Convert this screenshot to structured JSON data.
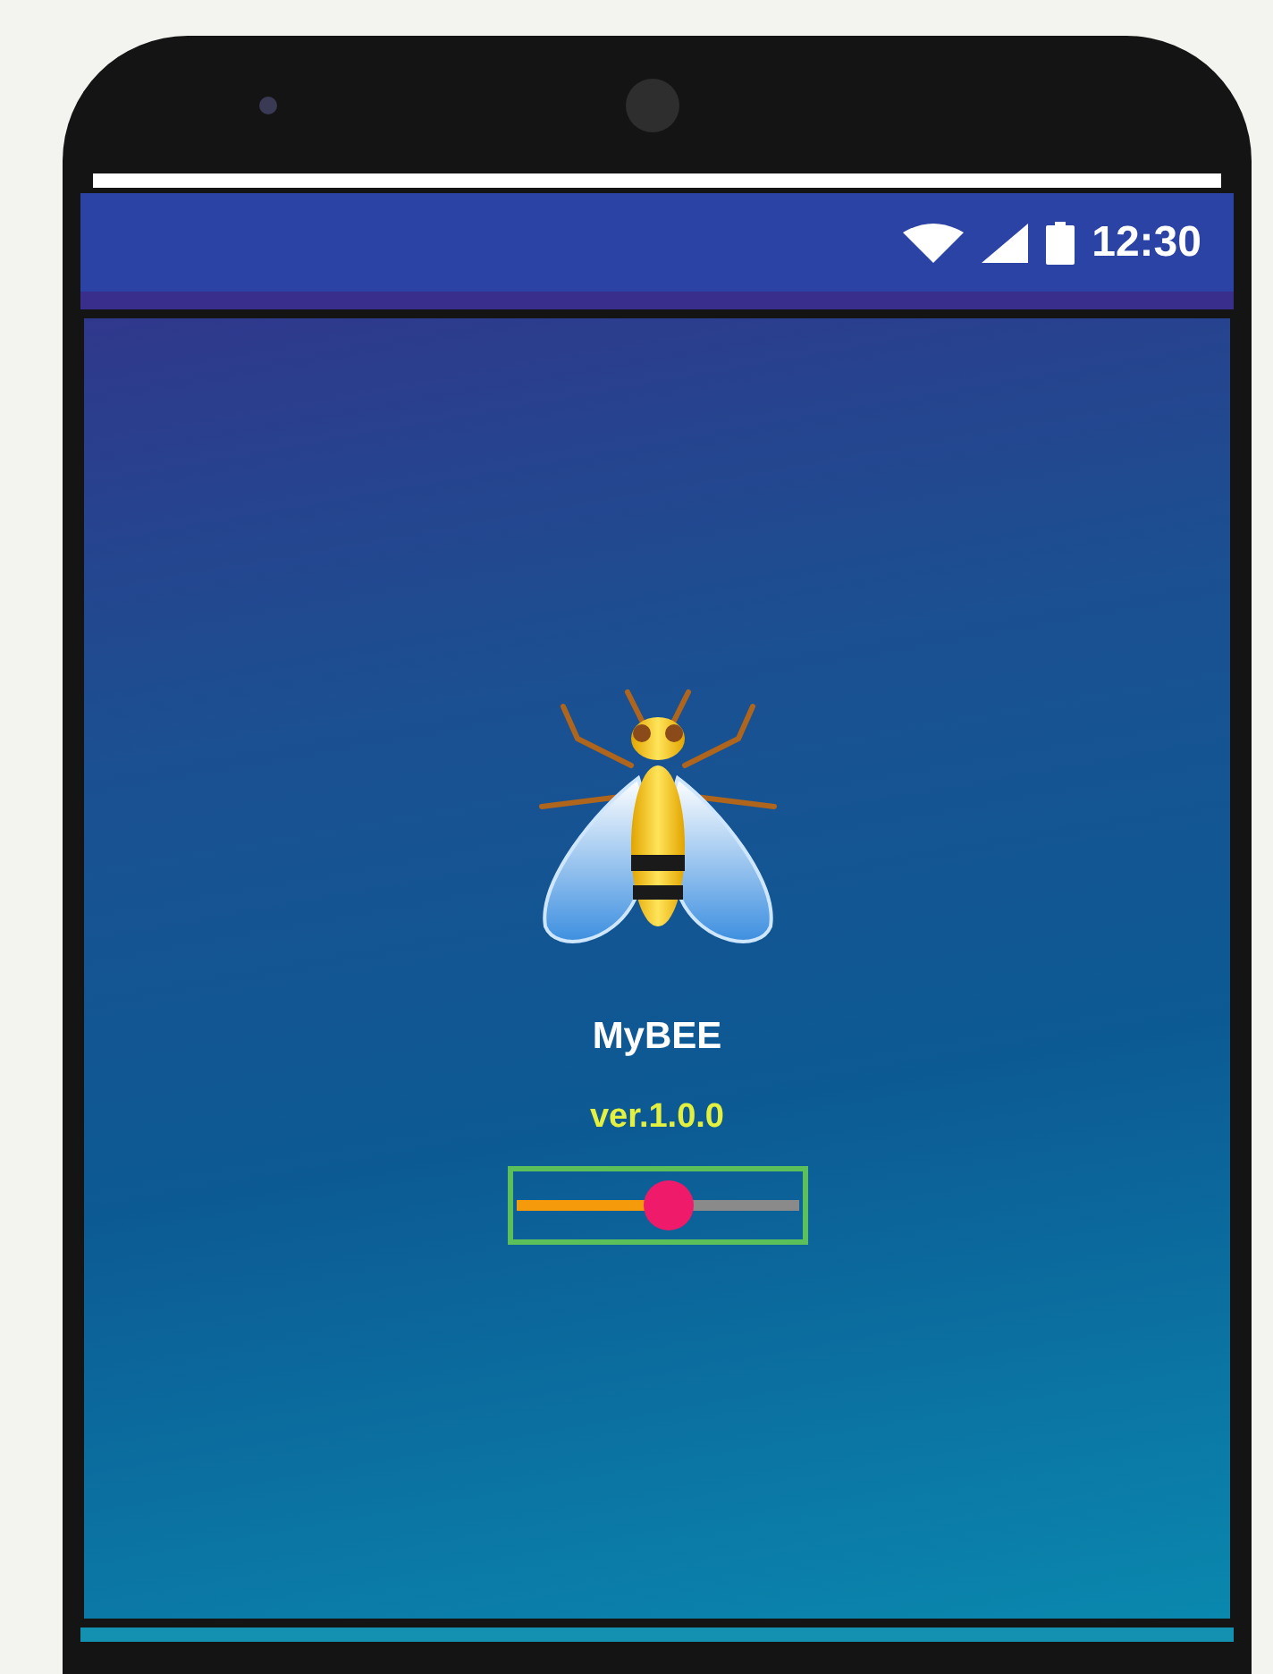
{
  "status_bar": {
    "time": "12:30"
  },
  "app": {
    "title": "MyBEE",
    "version": "ver.1.0.0"
  },
  "slider": {
    "level": 0.54
  }
}
